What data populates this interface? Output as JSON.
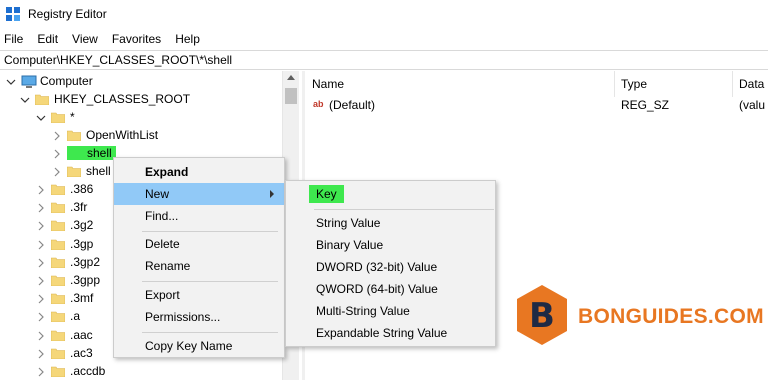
{
  "window": {
    "title": "Registry Editor"
  },
  "menubar": [
    "File",
    "Edit",
    "View",
    "Favorites",
    "Help"
  ],
  "address": "Computer\\HKEY_CLASSES_ROOT\\*\\shell",
  "tree": {
    "computer": "Computer",
    "hkcr": "HKEY_CLASSES_ROOT",
    "star": "*",
    "openwithlist": "OpenWithList",
    "shell": "shell",
    "shell2": "shell",
    "keys": [
      ".386",
      ".3fr",
      ".3g2",
      ".3gp",
      ".3gp2",
      ".3gpp",
      ".3mf",
      ".a",
      ".aac",
      ".ac3",
      ".accdb"
    ]
  },
  "list": {
    "columns": {
      "name": "Name",
      "type": "Type",
      "data": "Data"
    },
    "rows": [
      {
        "name": "(Default)",
        "type": "REG_SZ",
        "data": "(valu"
      }
    ]
  },
  "context_menu": {
    "expand": "Expand",
    "new": "New",
    "find": "Find...",
    "delete": "Delete",
    "rename": "Rename",
    "export": "Export",
    "permissions": "Permissions...",
    "copy_key_name": "Copy Key Name"
  },
  "submenu": {
    "key": "Key",
    "string": "String Value",
    "binary": "Binary Value",
    "dword": "DWORD (32-bit) Value",
    "qword": "QWORD (64-bit) Value",
    "multi": "Multi-String Value",
    "expandable": "Expandable String Value"
  },
  "watermark": {
    "logo_letter": "B",
    "text": "BONGUIDES.COM"
  },
  "colors": {
    "highlight_green": "#3ee84e",
    "menu_selected": "#91c9f7",
    "brand_orange": "#e87722",
    "folder": "#f5d77a"
  }
}
